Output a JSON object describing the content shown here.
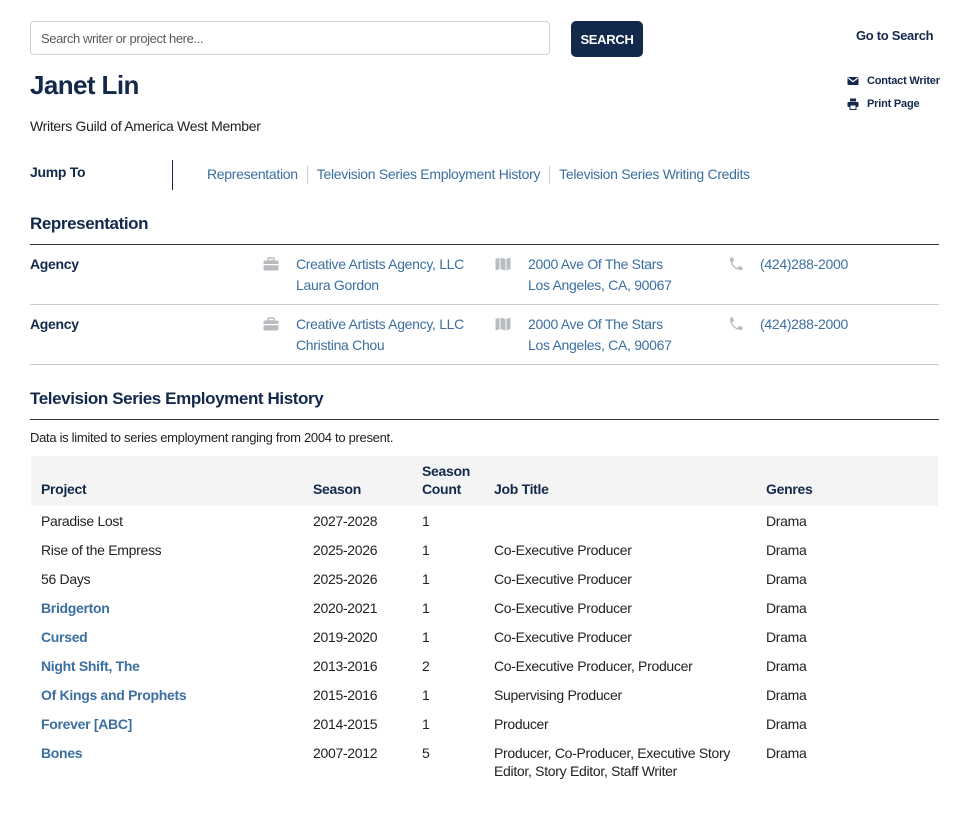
{
  "search": {
    "placeholder": "Search writer or project here...",
    "button_label": "SEARCH"
  },
  "header": {
    "goto_label": "Go to Search",
    "contact_label": "Contact Writer",
    "print_label": "Print Page"
  },
  "profile": {
    "name": "Janet Lin",
    "membership": "Writers Guild of America West Member"
  },
  "jump": {
    "label": "Jump To",
    "links": [
      "Representation",
      "Television Series Employment History",
      "Television Series Writing Credits"
    ]
  },
  "representation": {
    "title": "Representation",
    "rows": [
      {
        "type": "Agency",
        "agency": "Creative Artists Agency, LLC",
        "agent": "Laura Gordon",
        "address1": "2000 Ave Of The Stars",
        "address2": "Los Angeles, CA, 90067",
        "phone": "(424)288-2000"
      },
      {
        "type": "Agency",
        "agency": "Creative Artists Agency, LLC",
        "agent": "Christina Chou",
        "address1": "2000 Ave Of The Stars",
        "address2": "Los Angeles, CA, 90067",
        "phone": "(424)288-2000"
      }
    ]
  },
  "employment": {
    "title": "Television Series Employment History",
    "note": "Data is limited to series employment ranging from 2004 to present.",
    "columns": {
      "project": "Project",
      "season": "Season",
      "season_count_1": "Season",
      "season_count_2": "Count",
      "job_title": "Job Title",
      "genres": "Genres"
    },
    "rows": [
      {
        "project": "Paradise Lost",
        "link": false,
        "season": "2027-2028",
        "count": "1",
        "job": "",
        "genres": "Drama"
      },
      {
        "project": "Rise of the Empress",
        "link": false,
        "season": "2025-2026",
        "count": "1",
        "job": "Co-Executive Producer",
        "genres": "Drama"
      },
      {
        "project": "56 Days",
        "link": false,
        "season": "2025-2026",
        "count": "1",
        "job": "Co-Executive Producer",
        "genres": "Drama"
      },
      {
        "project": "Bridgerton",
        "link": true,
        "season": "2020-2021",
        "count": "1",
        "job": "Co-Executive Producer",
        "genres": "Drama"
      },
      {
        "project": "Cursed",
        "link": true,
        "season": "2019-2020",
        "count": "1",
        "job": "Co-Executive Producer",
        "genres": "Drama"
      },
      {
        "project": "Night Shift, The",
        "link": true,
        "season": "2013-2016",
        "count": "2",
        "job": "Co-Executive Producer, Producer",
        "genres": "Drama"
      },
      {
        "project": "Of Kings and Prophets",
        "link": true,
        "season": "2015-2016",
        "count": "1",
        "job": "Supervising Producer",
        "genres": "Drama"
      },
      {
        "project": "Forever [ABC]",
        "link": true,
        "season": "2014-2015",
        "count": "1",
        "job": "Producer",
        "genres": "Drama"
      },
      {
        "project": "Bones",
        "link": true,
        "season": "2007-2012",
        "count": "5",
        "job": "Producer, Co-Producer, Executive Story Editor, Story Editor, Staff Writer",
        "genres": "Drama"
      }
    ]
  },
  "colors": {
    "navy": "#13294b",
    "link": "#3b6fa0",
    "header_bg": "#f4f4f4",
    "divider": "#c9ccd0"
  },
  "icons": {
    "contact": "envelope-icon",
    "print": "printer-icon",
    "agency": "briefcase-icon",
    "address": "map-icon",
    "phone": "phone-icon"
  }
}
